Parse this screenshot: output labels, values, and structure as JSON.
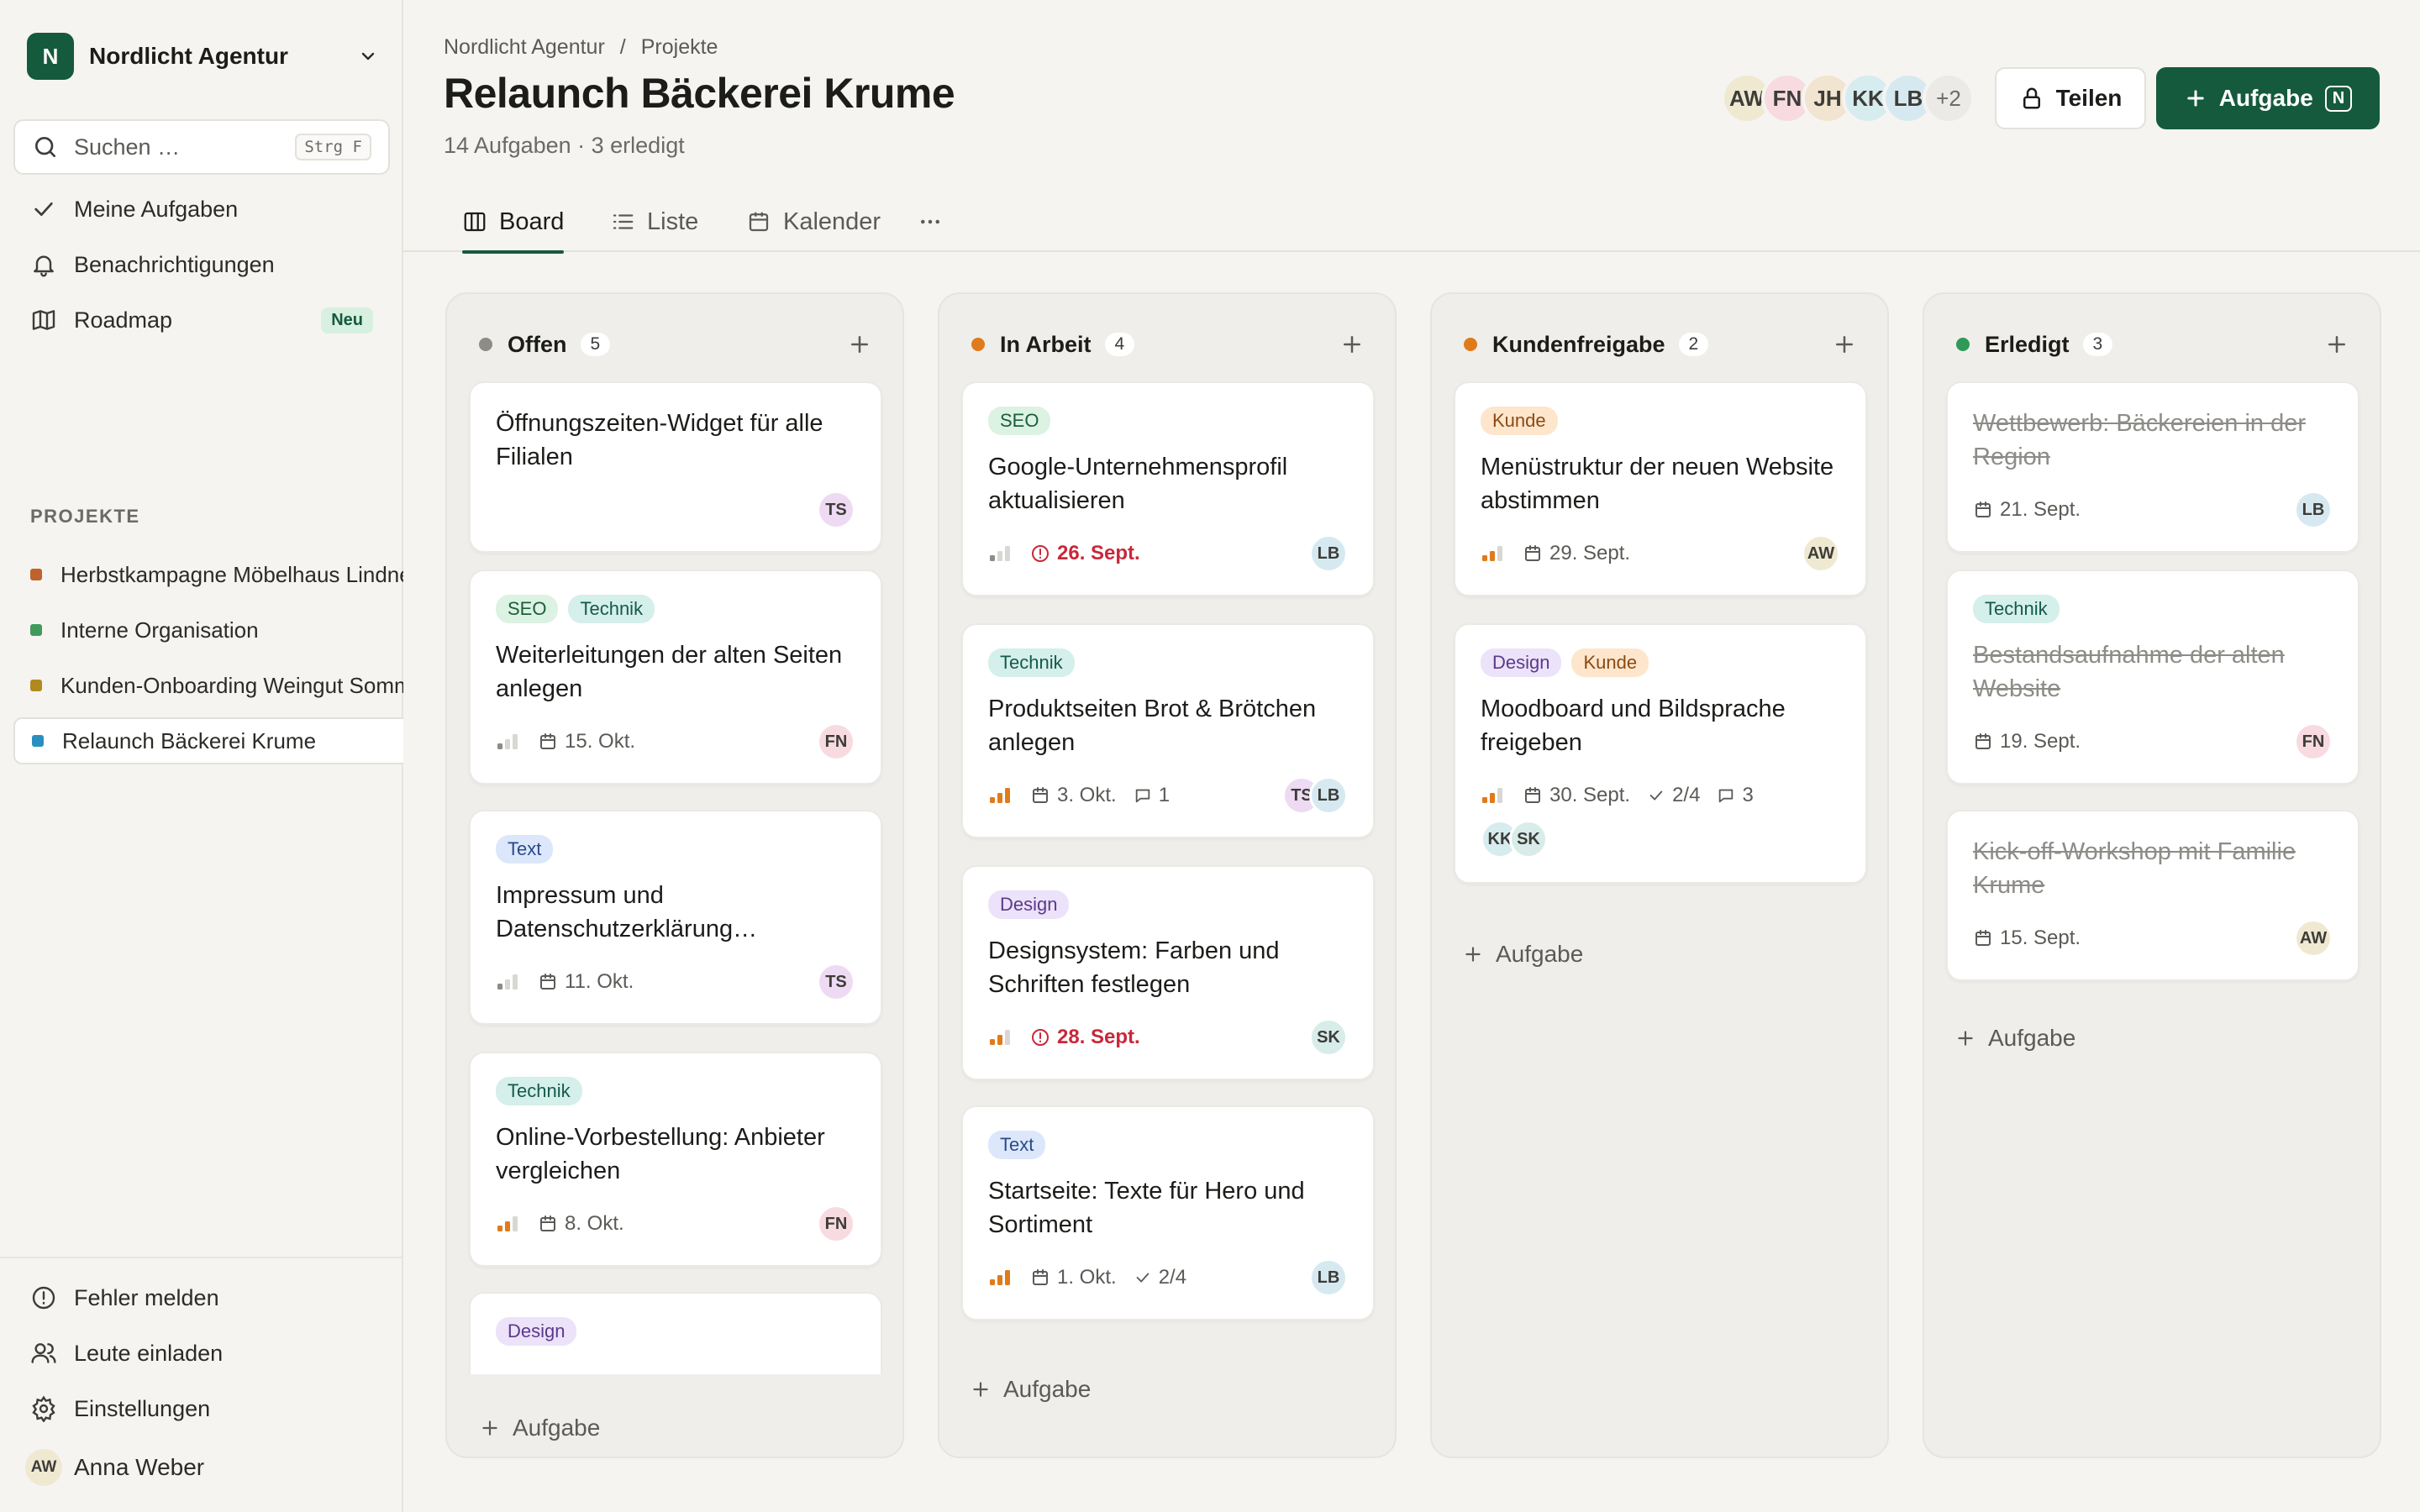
{
  "workspace": {
    "initial": "N",
    "name": "Nordlicht Agentur"
  },
  "search": {
    "placeholder": "Suchen …",
    "shortcut": "Strg F"
  },
  "nav": [
    {
      "label": "Meine Aufgaben",
      "icon": "check-icon"
    },
    {
      "label": "Benachrichtigungen",
      "icon": "bell-icon"
    },
    {
      "label": "Roadmap",
      "icon": "map-icon",
      "badge": "Neu"
    }
  ],
  "projects_heading": "PROJEKTE",
  "projects": [
    {
      "label": "Herbstkampagne Möbelhaus Lindner",
      "color": "#c0622b"
    },
    {
      "label": "Interne Organisation",
      "color": "#3f9a5b"
    },
    {
      "label": "Kunden-Onboarding Weingut Sommer",
      "color": "#b08a1e"
    },
    {
      "label": "Relaunch Bäckerei Krume",
      "color": "#2a8fc0",
      "active": true
    }
  ],
  "bottom_nav": [
    {
      "label": "Fehler melden",
      "icon": "alert-circle-icon"
    },
    {
      "label": "Leute einladen",
      "icon": "users-icon"
    },
    {
      "label": "Einstellungen",
      "icon": "gear-icon"
    }
  ],
  "user": {
    "initials": "AW",
    "name": "Anna Weber"
  },
  "breadcrumb": [
    "Nordlicht Agentur",
    "/",
    "Projekte"
  ],
  "page": {
    "title": "Relaunch Bäckerei Krume",
    "subtitle": "14 Aufgaben · 3 erledigt"
  },
  "members": [
    "AW",
    "FN",
    "JH",
    "KK",
    "LB"
  ],
  "members_more": "+2",
  "actions": {
    "share": "Teilen",
    "add": "Aufgabe",
    "add_key": "N"
  },
  "tabs": [
    {
      "label": "Board",
      "icon": "board-icon",
      "active": true
    },
    {
      "label": "Liste",
      "icon": "list-icon"
    },
    {
      "label": "Kalender",
      "icon": "calendar-icon"
    }
  ],
  "avatar_colors": {
    "AW": "#efe9d2",
    "FN": "#f7dbe0",
    "JH": "#f1e4d0",
    "KK": "#d6ecef",
    "LB": "#d7e9f0",
    "TS": "#eedaf2",
    "SK": "#d8ecea"
  },
  "columns": [
    {
      "name": "Offen",
      "count": "5",
      "color": "#8d8c87",
      "add_label": "Aufgabe",
      "cards": [
        {
          "tags": [],
          "title": "Öffnungszeiten-Widget für alle Filialen",
          "avatars": [
            "TS"
          ]
        },
        {
          "tags": [
            "SEO",
            "Technik"
          ],
          "title": "Weiterleitungen der alten Seiten anlegen",
          "priority": 1,
          "date": "15. Okt.",
          "avatars": [
            "FN"
          ]
        },
        {
          "tags": [
            "Text"
          ],
          "title": "Impressum und Datenschutzerklärung…",
          "priority": 1,
          "date": "11. Okt.",
          "avatars": [
            "TS"
          ]
        },
        {
          "tags": [
            "Technik"
          ],
          "title": "Online-Vorbestellung: Anbieter vergleichen",
          "priority": 2,
          "date": "8. Okt.",
          "avatars": [
            "FN"
          ]
        },
        {
          "tags": [
            "Design"
          ],
          "title": "",
          "avatars": []
        }
      ]
    },
    {
      "name": "In Arbeit",
      "count": "4",
      "color": "#e07b1c",
      "add_label": "Aufgabe",
      "cards": [
        {
          "tags": [
            "SEO"
          ],
          "title": "Google-Unternehmensprofil aktualisieren",
          "priority": 1,
          "date": "26. Sept.",
          "overdue": true,
          "avatars": [
            "LB"
          ]
        },
        {
          "tags": [
            "Technik"
          ],
          "title": "Produktseiten Brot & Brötchen anlegen",
          "priority": 3,
          "date": "3. Okt.",
          "comments": "1",
          "avatars": [
            "TS",
            "LB"
          ]
        },
        {
          "tags": [
            "Design"
          ],
          "title": "Designsystem: Farben und Schriften festlegen",
          "priority": 2,
          "date": "28. Sept.",
          "overdue": true,
          "avatars": [
            "SK"
          ]
        },
        {
          "tags": [
            "Text"
          ],
          "title": "Startseite: Texte für Hero und Sortiment",
          "priority": 3,
          "date": "1. Okt.",
          "checklist": "2/4",
          "avatars": [
            "LB"
          ]
        }
      ]
    },
    {
      "name": "Kundenfreigabe",
      "count": "2",
      "color": "#e07b1c",
      "add_label": "Aufgabe",
      "cards": [
        {
          "tags": [
            "Kunde"
          ],
          "title": "Menüstruktur der neuen Website abstimmen",
          "priority": 2,
          "date": "29. Sept.",
          "avatars": [
            "AW"
          ]
        },
        {
          "tags": [
            "Design",
            "Kunde"
          ],
          "title": "Moodboard und Bildsprache freigeben",
          "priority": 2,
          "date": "30. Sept.",
          "checklist": "2/4",
          "comments": "3",
          "avatars_below": [
            "KK",
            "SK"
          ],
          "avatars": []
        }
      ]
    },
    {
      "name": "Erledigt",
      "count": "3",
      "color": "#2f9a57",
      "add_label": "Aufgabe",
      "cards": [
        {
          "tags": [],
          "title": "Wettbewerb: Bäckereien in der Region",
          "done": true,
          "date": "21. Sept.",
          "avatars": [
            "LB"
          ]
        },
        {
          "tags": [
            "Technik"
          ],
          "title": "Bestandsaufnahme der alten Website",
          "done": true,
          "date": "19. Sept.",
          "avatars": [
            "FN"
          ]
        },
        {
          "tags": [],
          "title": "Kick-off-Workshop mit Familie Krume",
          "done": true,
          "date": "15. Sept.",
          "avatars": [
            "AW"
          ]
        }
      ]
    }
  ]
}
